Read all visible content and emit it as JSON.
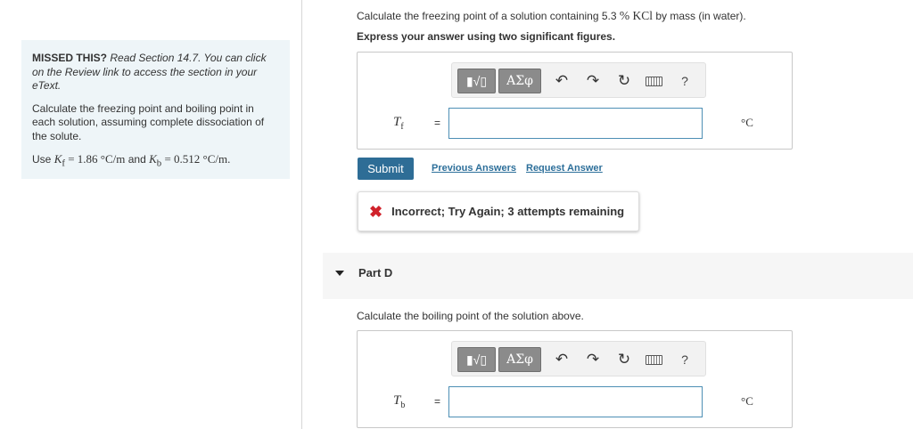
{
  "hint": {
    "title": "MISSED THIS?",
    "body": "Read Section 14.7. You can click on the Review link to access the section in your eText.",
    "instruction": "Calculate the freezing point and boiling point in each solution, assuming complete dissociation of the solute.",
    "use_prefix": "Use",
    "kf_label": "K",
    "kf_sub": "f",
    "kf_value": "= 1.86 °C/m",
    "and_text": "and",
    "kb_label": "K",
    "kb_sub": "b",
    "kb_value": "= 0.512 °C/m."
  },
  "part_c": {
    "question_prefix": "Calculate the freezing point of a solution containing 5.3",
    "question_percent": "% KCl",
    "question_suffix": "by mass (in water).",
    "instruction": "Express your answer using two significant figures.",
    "toolbar": {
      "templates_label": "▮√▯",
      "symbols_label": "ΑΣφ",
      "undo_icon": "↶",
      "redo_icon": "↷",
      "reset_icon": "↻",
      "help_label": "?"
    },
    "variable": "T",
    "variable_sub": "f",
    "equals": "=",
    "input_value": "",
    "unit": "°C",
    "submit_label": "Submit",
    "previous_answers_label": "Previous Answers",
    "request_answer_label": "Request Answer",
    "feedback_icon": "✖",
    "feedback_text": "Incorrect; Try Again; 3 attempts remaining"
  },
  "part_d": {
    "title": "Part D",
    "question": "Calculate the boiling point of the solution above.",
    "toolbar": {
      "templates_label": "▮√▯",
      "symbols_label": "ΑΣφ",
      "undo_icon": "↶",
      "redo_icon": "↷",
      "reset_icon": "↻",
      "help_label": "?"
    },
    "variable": "T",
    "variable_sub": "b",
    "equals": "=",
    "input_value": "",
    "unit": "°C"
  },
  "colors": {
    "submit_bg": "#2e6d96",
    "link": "#2d6f9a",
    "hint_bg": "#eef5f8",
    "error_icon": "#d0222b"
  }
}
